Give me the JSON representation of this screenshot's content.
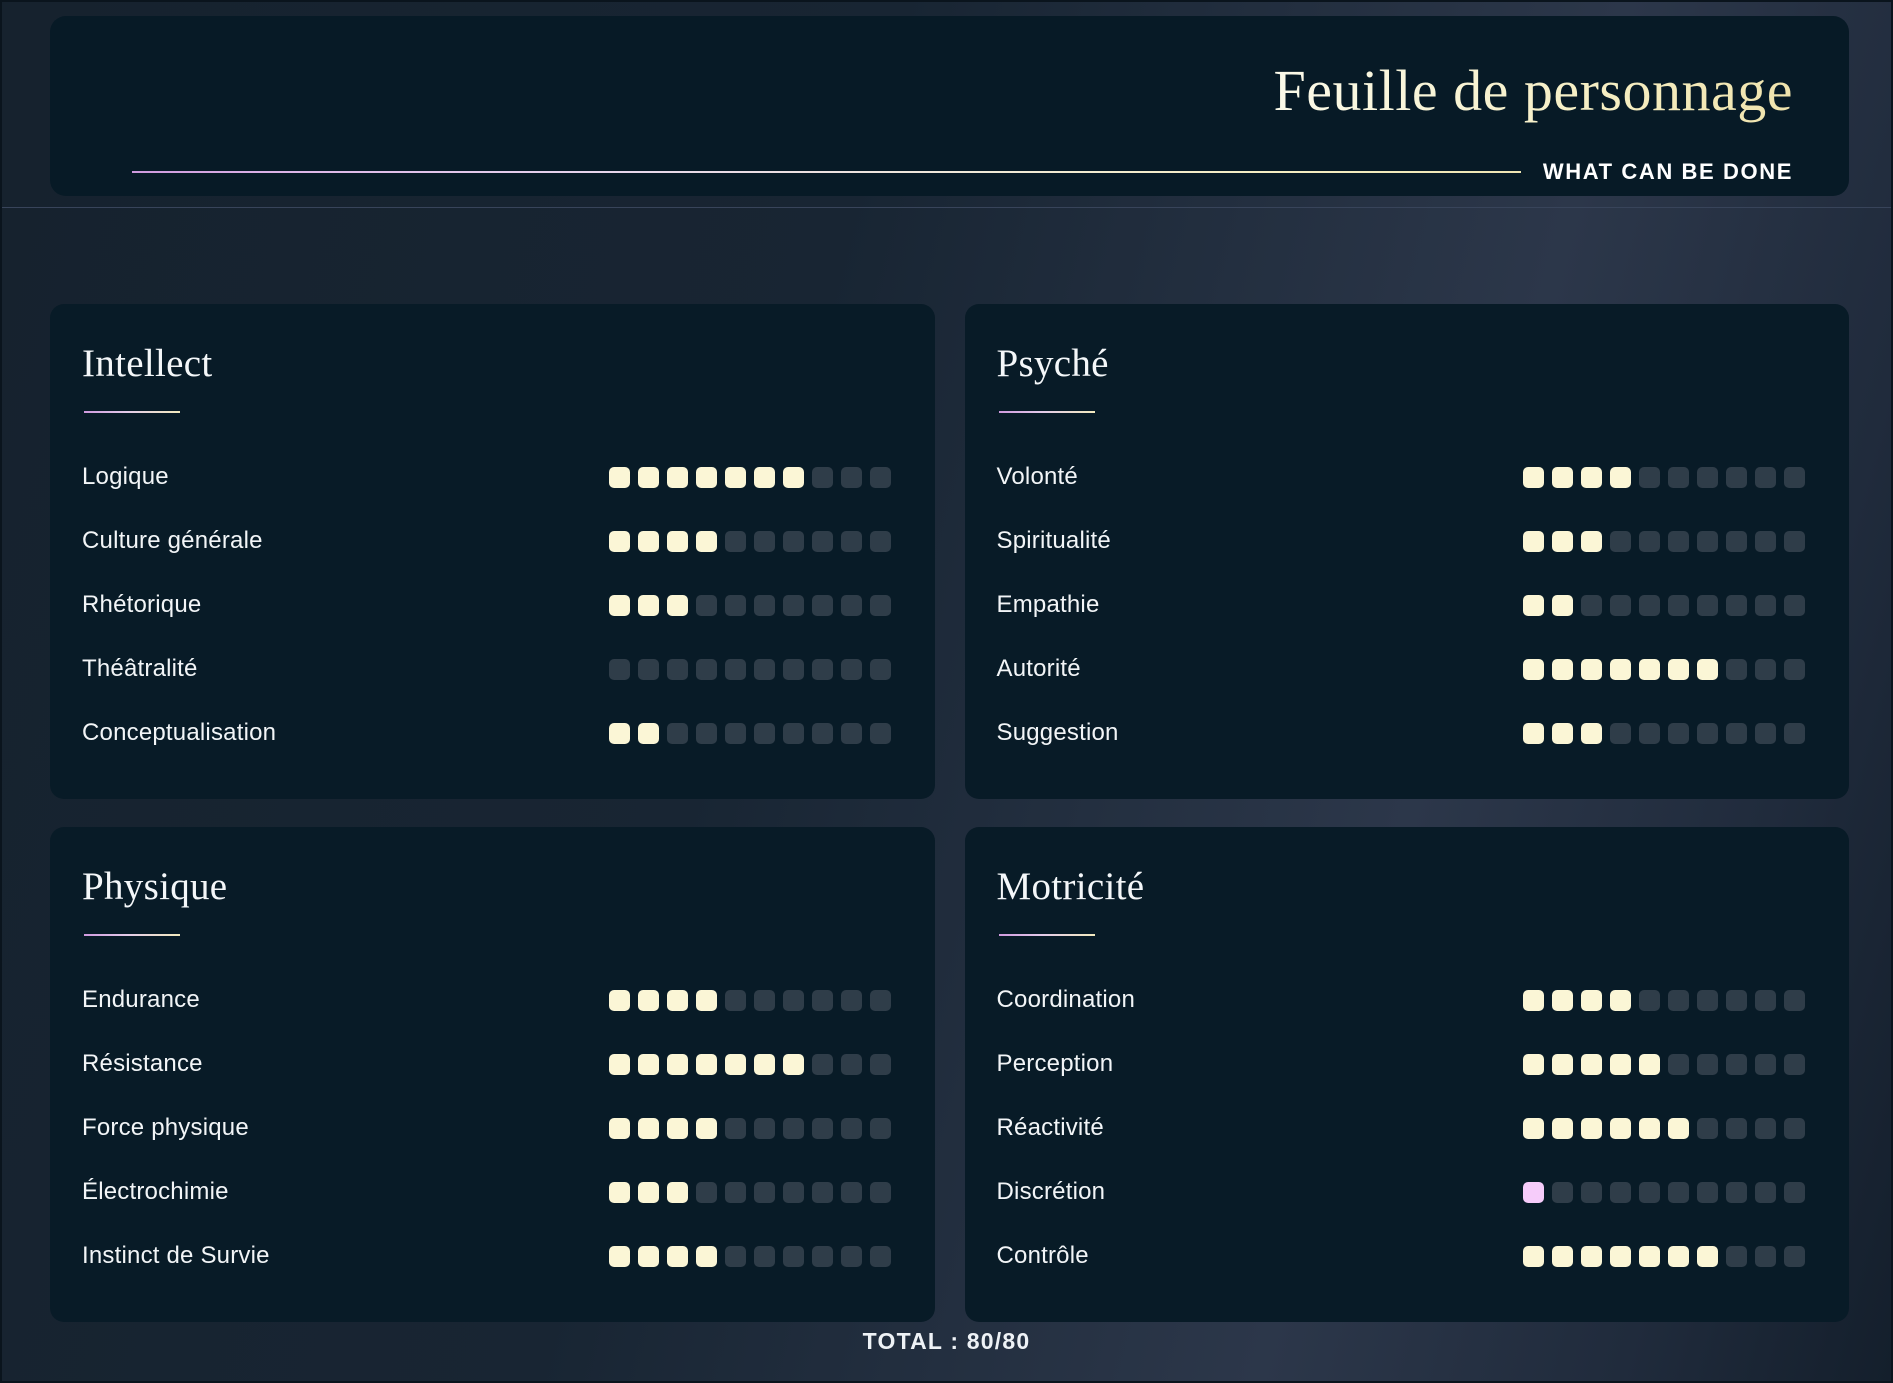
{
  "header": {
    "title": "Feuille de personnage",
    "subtitle": "WHAT CAN BE DONE"
  },
  "cards": [
    {
      "title": "Intellect",
      "stats": [
        {
          "label": "Logique",
          "value": 7,
          "max": 10
        },
        {
          "label": "Culture générale",
          "value": 4,
          "max": 10
        },
        {
          "label": "Rhétorique",
          "value": 3,
          "max": 10
        },
        {
          "label": "Théâtralité",
          "value": 0,
          "max": 10
        },
        {
          "label": "Conceptualisation",
          "value": 2,
          "max": 10
        }
      ]
    },
    {
      "title": "Psyché",
      "stats": [
        {
          "label": "Volonté",
          "value": 4,
          "max": 10
        },
        {
          "label": "Spiritualité",
          "value": 3,
          "max": 10
        },
        {
          "label": "Empathie",
          "value": 2,
          "max": 10
        },
        {
          "label": "Autorité",
          "value": 7,
          "max": 10
        },
        {
          "label": "Suggestion",
          "value": 3,
          "max": 10
        }
      ]
    },
    {
      "title": "Physique",
      "stats": [
        {
          "label": "Endurance",
          "value": 4,
          "max": 10
        },
        {
          "label": "Résistance",
          "value": 7,
          "max": 10
        },
        {
          "label": "Force physique",
          "value": 4,
          "max": 10
        },
        {
          "label": "Électrochimie",
          "value": 3,
          "max": 10
        },
        {
          "label": "Instinct de Survie",
          "value": 4,
          "max": 10
        }
      ]
    },
    {
      "title": "Motricité",
      "stats": [
        {
          "label": "Coordination",
          "value": 4,
          "max": 10
        },
        {
          "label": "Perception",
          "value": 5,
          "max": 10
        },
        {
          "label": "Réactivité",
          "value": 6,
          "max": 10
        },
        {
          "label": "Discrétion",
          "value": 1,
          "max": 10,
          "highlight": true
        },
        {
          "label": "Contrôle",
          "value": 7,
          "max": 10
        }
      ]
    }
  ],
  "footer": {
    "total_label": "TOTAL : 80/80"
  },
  "colors": {
    "page_background": "#16222e",
    "card_background": "#081b27",
    "pip_filled": "#fbf6d6",
    "pip_empty": "#2f3d49",
    "pip_highlight": "#f6ccfa",
    "accent_pink": "#cf9ade",
    "accent_cream": "#f2ebbf",
    "text_primary": "#f2f5f7"
  }
}
